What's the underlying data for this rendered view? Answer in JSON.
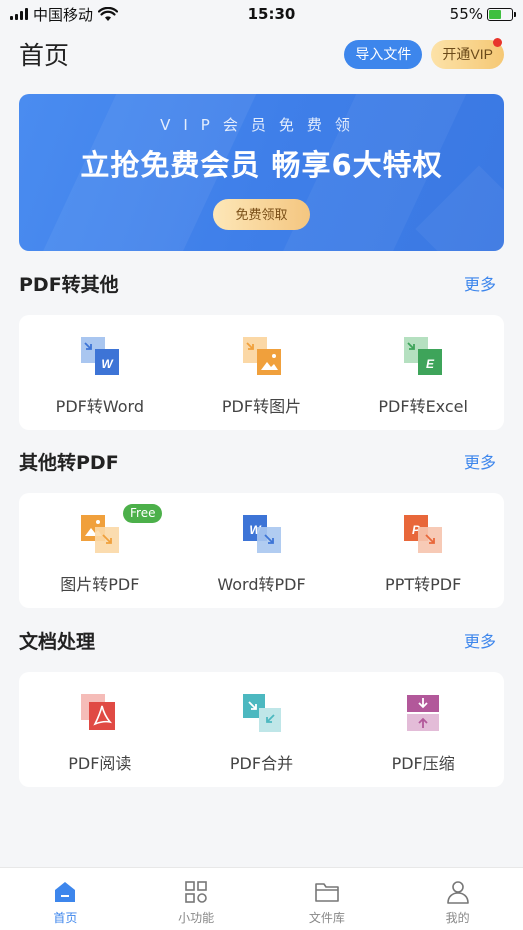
{
  "status_bar": {
    "carrier": "中国移动",
    "time": "15:30",
    "battery": "55%",
    "battery_level": 0.55
  },
  "header": {
    "title": "首页",
    "import_label": "导入文件",
    "vip_label": "开通VIP"
  },
  "banner": {
    "subtitle": "VIP会员免费领",
    "title": "立抢免费会员  畅享6大特权",
    "button_label": "免费领取"
  },
  "sections": [
    {
      "title": "PDF转其他",
      "more": "更多",
      "tools": [
        {
          "label": "PDF转Word",
          "icon": "pdf-to-word-icon"
        },
        {
          "label": "PDF转图片",
          "icon": "pdf-to-image-icon"
        },
        {
          "label": "PDF转Excel",
          "icon": "pdf-to-excel-icon"
        }
      ]
    },
    {
      "title": "其他转PDF",
      "more": "更多",
      "tools": [
        {
          "label": "图片转PDF",
          "icon": "image-to-pdf-icon",
          "badge": "Free"
        },
        {
          "label": "Word转PDF",
          "icon": "word-to-pdf-icon"
        },
        {
          "label": "PPT转PDF",
          "icon": "ppt-to-pdf-icon"
        }
      ]
    },
    {
      "title": "文档处理",
      "more": "更多",
      "tools": [
        {
          "label": "PDF阅读",
          "icon": "pdf-reader-icon"
        },
        {
          "label": "PDF合并",
          "icon": "pdf-merge-icon"
        },
        {
          "label": "PDF压缩",
          "icon": "pdf-compress-icon"
        }
      ]
    }
  ],
  "tabbar": [
    {
      "label": "首页",
      "icon": "home-icon",
      "active": true
    },
    {
      "label": "小功能",
      "icon": "grid-icon"
    },
    {
      "label": "文件库",
      "icon": "folder-icon"
    },
    {
      "label": "我的",
      "icon": "user-icon"
    }
  ],
  "colors": {
    "accent": "#3d86ec",
    "word": "#3d74d6",
    "excel": "#3ea45a",
    "ppt": "#e8673a",
    "image": "#f0a03c",
    "pdf": "#e04a44",
    "merge": "#4cb8c0",
    "compress": "#b2589a",
    "free_badge": "#4cb04a"
  }
}
